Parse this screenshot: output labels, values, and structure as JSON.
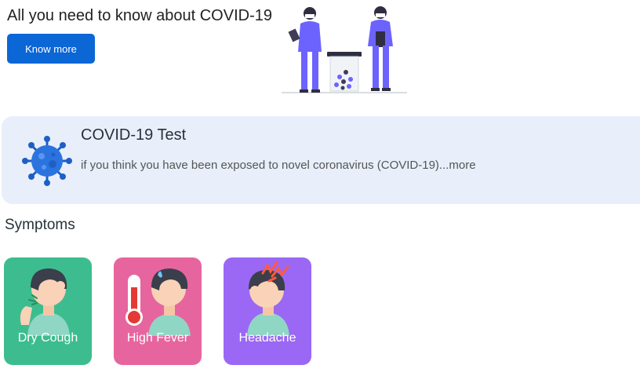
{
  "hero": {
    "title": "All you need to know about COVID-19",
    "button_label": "Know more"
  },
  "test_card": {
    "title": "COVID-19 Test",
    "description": "if you think you have been exposed to novel coronavirus (COVID-19)...more",
    "icon": "virus-icon"
  },
  "symptoms": {
    "heading": "Symptoms",
    "items": [
      {
        "label": "Dry Cough",
        "color": "#3dbd8f",
        "icon": "cough-icon"
      },
      {
        "label": "High Fever",
        "color": "#e7659e",
        "icon": "thermometer-icon"
      },
      {
        "label": "Headache",
        "color": "#9a68f4",
        "icon": "headache-icon"
      }
    ]
  },
  "colors": {
    "primary": "#0b66d6",
    "card_background": "#e8effa"
  }
}
